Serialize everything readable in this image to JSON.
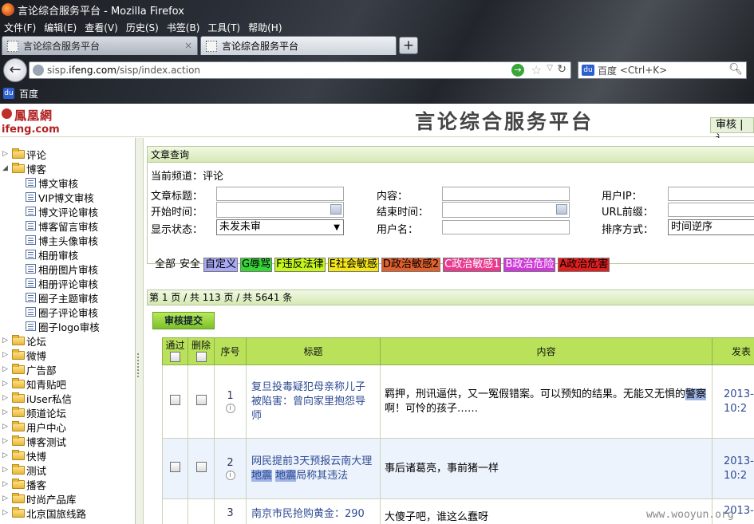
{
  "window": {
    "title": "言论综合服务平台 - Mozilla Firefox"
  },
  "menu": [
    "文件(F)",
    "编辑(E)",
    "查看(V)",
    "历史(S)",
    "书签(B)",
    "工具(T)",
    "帮助(H)"
  ],
  "tabs": [
    {
      "label": "言论综合服务平台",
      "close": "×"
    },
    {
      "label": "言论综合服务平台"
    }
  ],
  "newtab": "+",
  "nav": {
    "url_prefix": "sisp.",
    "url_domain": "ifeng.com",
    "url_rest": "/sisp/index.action",
    "search_engine": "百度",
    "search_placeholder": "<Ctrl+K>"
  },
  "bookmarks": [
    "百度"
  ],
  "header": {
    "logo_cn": "鳳凰網",
    "logo_en": "ifeng.com",
    "title": "言论综合服务平台",
    "audit_link": "审核 | 讠"
  },
  "sidebar": [
    {
      "label": "评论",
      "type": "folder",
      "expanded": false
    },
    {
      "label": "博客",
      "type": "folder",
      "expanded": true
    },
    {
      "label": "博文审核",
      "type": "leaf"
    },
    {
      "label": "VIP博文审核",
      "type": "leaf"
    },
    {
      "label": "博文评论审核",
      "type": "leaf"
    },
    {
      "label": "博客留言审核",
      "type": "leaf"
    },
    {
      "label": "博主头像审核",
      "type": "leaf"
    },
    {
      "label": "相册审核",
      "type": "leaf"
    },
    {
      "label": "相册图片审核",
      "type": "leaf"
    },
    {
      "label": "相册评论审核",
      "type": "leaf"
    },
    {
      "label": "圈子主题审核",
      "type": "leaf"
    },
    {
      "label": "圈子评论审核",
      "type": "leaf"
    },
    {
      "label": "圈子logo审核",
      "type": "leaf"
    },
    {
      "label": "论坛",
      "type": "folder",
      "expanded": false
    },
    {
      "label": "微博",
      "type": "folder",
      "expanded": false
    },
    {
      "label": "广告部",
      "type": "folder",
      "expanded": false
    },
    {
      "label": "知青贴吧",
      "type": "folder",
      "expanded": false
    },
    {
      "label": "iUser私信",
      "type": "folder",
      "expanded": false
    },
    {
      "label": "频道论坛",
      "type": "folder",
      "expanded": false
    },
    {
      "label": "用户中心",
      "type": "folder",
      "expanded": false
    },
    {
      "label": "博客测试",
      "type": "folder",
      "expanded": false
    },
    {
      "label": "快博",
      "type": "folder",
      "expanded": false
    },
    {
      "label": "测试",
      "type": "folder",
      "expanded": false
    },
    {
      "label": "播客",
      "type": "folder",
      "expanded": false
    },
    {
      "label": "时尚产品库",
      "type": "folder",
      "expanded": false
    },
    {
      "label": "北京国旅线路",
      "type": "folder",
      "expanded": false
    }
  ],
  "query": {
    "panel_title": "文章查询",
    "current_channel": "当前频道：评论",
    "labels": {
      "title": "文章标题：",
      "content": "内容：",
      "user_ip": "用户IP：",
      "start_time": "开始时间：",
      "end_time": "结束时间：",
      "url_prefix": "URL前缀：",
      "display_status": "显示状态：",
      "username": "用户名：",
      "sort": "排序方式："
    },
    "display_status_value": "未发未审",
    "sort_value": "时间逆序"
  },
  "filters": [
    {
      "label": "全部",
      "bg": "",
      "color": "#000"
    },
    {
      "label": "安全",
      "bg": "",
      "color": "#000"
    },
    {
      "label": "自定义",
      "bg": "#a9a9f5",
      "color": "#000"
    },
    {
      "label": "G辱骂",
      "bg": "#37d637",
      "color": "#000"
    },
    {
      "label": "F违反法律",
      "bg": "#c6f71c",
      "color": "#000"
    },
    {
      "label": "E社会敏感",
      "bg": "#f5e61c",
      "color": "#000"
    },
    {
      "label": "D政治敏感2",
      "bg": "#e0602e",
      "color": "#000"
    },
    {
      "label": "C政治敏感1",
      "bg": "#e93a8f",
      "color": "#fff"
    },
    {
      "label": "B政治危险",
      "bg": "#cf38d9",
      "color": "#fff"
    },
    {
      "label": "A政治危害",
      "bg": "#e02020",
      "color": "#000"
    }
  ],
  "pager": "第 1 页 / 共 113 页 / 共 5641 条",
  "submit_label": "审核提交",
  "table": {
    "headers": {
      "pass": "通过",
      "delete": "删除",
      "index": "序号",
      "title": "标题",
      "content": "内容",
      "date": "发表"
    },
    "rows": [
      {
        "index": "1",
        "title": "复旦投毒疑犯母亲称儿子被陷害：曾向家里抱怨导师",
        "content_a": "羁押，刑讯逼供，又一冤假错案。可以预知的结果。无能又无惧的",
        "content_hl": "警察",
        "content_b": "啊！可怜的孩子……",
        "date_a": "2013-",
        "date_b": "10:2"
      },
      {
        "index": "2",
        "title_a": "网民提前3天预报云南大理",
        "title_hl1": "地震",
        "title_mid": " ",
        "title_hl2": "地震",
        "title_b": "局称其违法",
        "content": "事后诸葛亮，事前猪一样",
        "date_a": "2013-",
        "date_b": "10:2"
      },
      {
        "index": "3",
        "title": "南京市民抢购黄金：290",
        "content": "大傻子吧，谁这么蠢呀",
        "date_a": "2013-"
      }
    ]
  },
  "watermark": "www.wooyun.org"
}
